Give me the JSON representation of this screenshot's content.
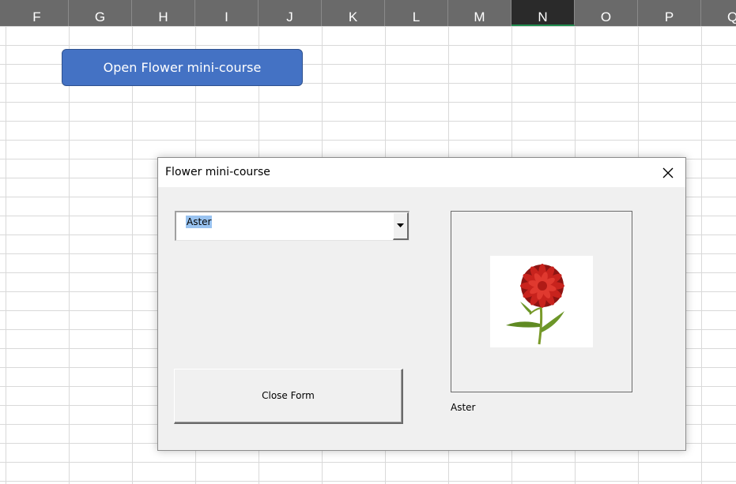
{
  "sheet": {
    "columns": [
      {
        "label": "F",
        "selected": false
      },
      {
        "label": "G",
        "selected": false
      },
      {
        "label": "H",
        "selected": false
      },
      {
        "label": "I",
        "selected": false
      },
      {
        "label": "J",
        "selected": false
      },
      {
        "label": "K",
        "selected": false
      },
      {
        "label": "L",
        "selected": false
      },
      {
        "label": "M",
        "selected": false
      },
      {
        "label": "N",
        "selected": true
      },
      {
        "label": "O",
        "selected": false
      },
      {
        "label": "P",
        "selected": false
      },
      {
        "label": "Q",
        "selected": false
      }
    ],
    "open_button_label": "Open Flower mini-course",
    "colors": {
      "header_bg": "#6a6a6a",
      "selected_header_bg": "#2a2a2a",
      "selected_header_accent": "#1f8a4c",
      "button_bg": "#4472c4",
      "gridline": "#d9d9d9"
    }
  },
  "dialog": {
    "title": "Flower mini-course",
    "close_icon": "close-icon",
    "combo": {
      "selected_value": "Aster",
      "dropdown_icon": "dropdown-arrow-icon"
    },
    "close_button_label": "Close Form",
    "image": {
      "subject": "red aster flower",
      "caption": "Aster"
    },
    "colors": {
      "body_bg": "#f0f0f0",
      "selection_highlight": "#99c3f0"
    }
  }
}
